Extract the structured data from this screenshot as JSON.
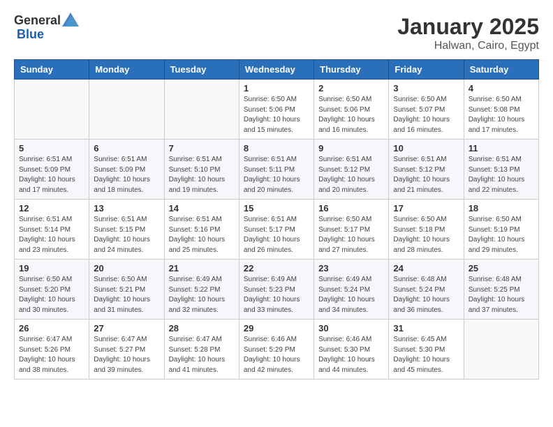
{
  "header": {
    "logo_general": "General",
    "logo_blue": "Blue",
    "month_title": "January 2025",
    "subtitle": "Halwan, Cairo, Egypt"
  },
  "weekdays": [
    "Sunday",
    "Monday",
    "Tuesday",
    "Wednesday",
    "Thursday",
    "Friday",
    "Saturday"
  ],
  "weeks": [
    [
      {
        "day": "",
        "info": ""
      },
      {
        "day": "",
        "info": ""
      },
      {
        "day": "",
        "info": ""
      },
      {
        "day": "1",
        "info": "Sunrise: 6:50 AM\nSunset: 5:06 PM\nDaylight: 10 hours\nand 15 minutes."
      },
      {
        "day": "2",
        "info": "Sunrise: 6:50 AM\nSunset: 5:06 PM\nDaylight: 10 hours\nand 16 minutes."
      },
      {
        "day": "3",
        "info": "Sunrise: 6:50 AM\nSunset: 5:07 PM\nDaylight: 10 hours\nand 16 minutes."
      },
      {
        "day": "4",
        "info": "Sunrise: 6:50 AM\nSunset: 5:08 PM\nDaylight: 10 hours\nand 17 minutes."
      }
    ],
    [
      {
        "day": "5",
        "info": "Sunrise: 6:51 AM\nSunset: 5:09 PM\nDaylight: 10 hours\nand 17 minutes."
      },
      {
        "day": "6",
        "info": "Sunrise: 6:51 AM\nSunset: 5:09 PM\nDaylight: 10 hours\nand 18 minutes."
      },
      {
        "day": "7",
        "info": "Sunrise: 6:51 AM\nSunset: 5:10 PM\nDaylight: 10 hours\nand 19 minutes."
      },
      {
        "day": "8",
        "info": "Sunrise: 6:51 AM\nSunset: 5:11 PM\nDaylight: 10 hours\nand 20 minutes."
      },
      {
        "day": "9",
        "info": "Sunrise: 6:51 AM\nSunset: 5:12 PM\nDaylight: 10 hours\nand 20 minutes."
      },
      {
        "day": "10",
        "info": "Sunrise: 6:51 AM\nSunset: 5:12 PM\nDaylight: 10 hours\nand 21 minutes."
      },
      {
        "day": "11",
        "info": "Sunrise: 6:51 AM\nSunset: 5:13 PM\nDaylight: 10 hours\nand 22 minutes."
      }
    ],
    [
      {
        "day": "12",
        "info": "Sunrise: 6:51 AM\nSunset: 5:14 PM\nDaylight: 10 hours\nand 23 minutes."
      },
      {
        "day": "13",
        "info": "Sunrise: 6:51 AM\nSunset: 5:15 PM\nDaylight: 10 hours\nand 24 minutes."
      },
      {
        "day": "14",
        "info": "Sunrise: 6:51 AM\nSunset: 5:16 PM\nDaylight: 10 hours\nand 25 minutes."
      },
      {
        "day": "15",
        "info": "Sunrise: 6:51 AM\nSunset: 5:17 PM\nDaylight: 10 hours\nand 26 minutes."
      },
      {
        "day": "16",
        "info": "Sunrise: 6:50 AM\nSunset: 5:17 PM\nDaylight: 10 hours\nand 27 minutes."
      },
      {
        "day": "17",
        "info": "Sunrise: 6:50 AM\nSunset: 5:18 PM\nDaylight: 10 hours\nand 28 minutes."
      },
      {
        "day": "18",
        "info": "Sunrise: 6:50 AM\nSunset: 5:19 PM\nDaylight: 10 hours\nand 29 minutes."
      }
    ],
    [
      {
        "day": "19",
        "info": "Sunrise: 6:50 AM\nSunset: 5:20 PM\nDaylight: 10 hours\nand 30 minutes."
      },
      {
        "day": "20",
        "info": "Sunrise: 6:50 AM\nSunset: 5:21 PM\nDaylight: 10 hours\nand 31 minutes."
      },
      {
        "day": "21",
        "info": "Sunrise: 6:49 AM\nSunset: 5:22 PM\nDaylight: 10 hours\nand 32 minutes."
      },
      {
        "day": "22",
        "info": "Sunrise: 6:49 AM\nSunset: 5:23 PM\nDaylight: 10 hours\nand 33 minutes."
      },
      {
        "day": "23",
        "info": "Sunrise: 6:49 AM\nSunset: 5:24 PM\nDaylight: 10 hours\nand 34 minutes."
      },
      {
        "day": "24",
        "info": "Sunrise: 6:48 AM\nSunset: 5:24 PM\nDaylight: 10 hours\nand 36 minutes."
      },
      {
        "day": "25",
        "info": "Sunrise: 6:48 AM\nSunset: 5:25 PM\nDaylight: 10 hours\nand 37 minutes."
      }
    ],
    [
      {
        "day": "26",
        "info": "Sunrise: 6:47 AM\nSunset: 5:26 PM\nDaylight: 10 hours\nand 38 minutes."
      },
      {
        "day": "27",
        "info": "Sunrise: 6:47 AM\nSunset: 5:27 PM\nDaylight: 10 hours\nand 39 minutes."
      },
      {
        "day": "28",
        "info": "Sunrise: 6:47 AM\nSunset: 5:28 PM\nDaylight: 10 hours\nand 41 minutes."
      },
      {
        "day": "29",
        "info": "Sunrise: 6:46 AM\nSunset: 5:29 PM\nDaylight: 10 hours\nand 42 minutes."
      },
      {
        "day": "30",
        "info": "Sunrise: 6:46 AM\nSunset: 5:30 PM\nDaylight: 10 hours\nand 44 minutes."
      },
      {
        "day": "31",
        "info": "Sunrise: 6:45 AM\nSunset: 5:30 PM\nDaylight: 10 hours\nand 45 minutes."
      },
      {
        "day": "",
        "info": ""
      }
    ]
  ]
}
